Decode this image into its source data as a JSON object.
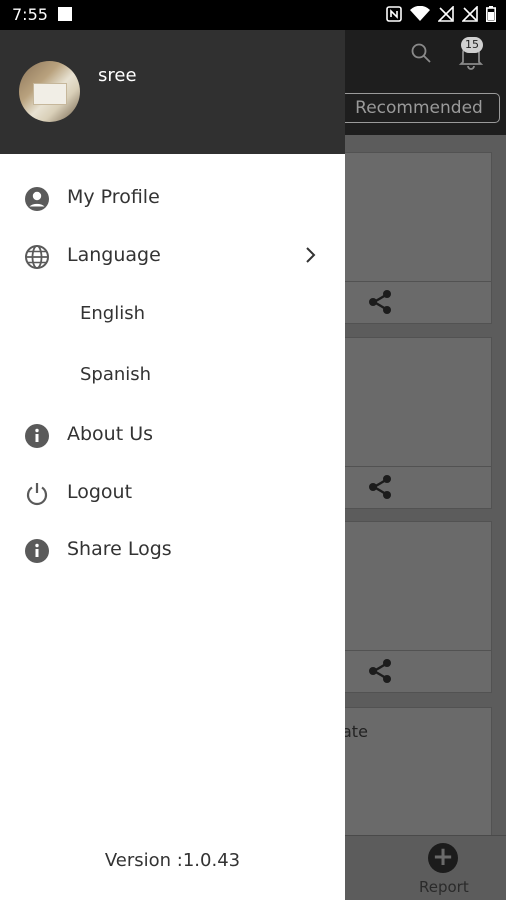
{
  "status_bar": {
    "time": "7:55"
  },
  "background": {
    "notification_count": "15",
    "recommended_tab": "Recommended",
    "partial_card_text": "ate",
    "report_label": "Report"
  },
  "drawer": {
    "username": "sree",
    "menu": {
      "my_profile": "My Profile",
      "language": "Language",
      "english": "English",
      "spanish": "Spanish",
      "about_us": "About Us",
      "logout": "Logout",
      "share_logs": "Share Logs"
    },
    "version": "Version :1.0.43"
  }
}
